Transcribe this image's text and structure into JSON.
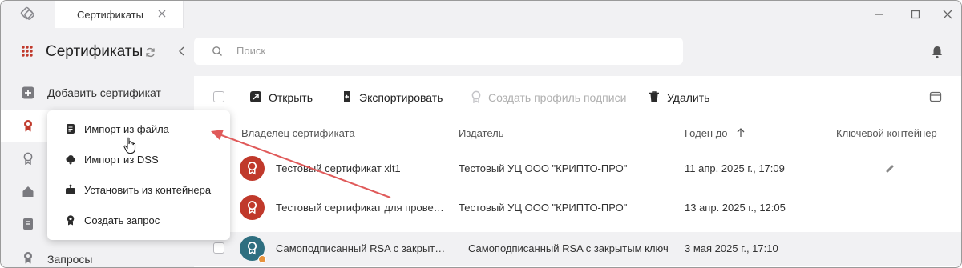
{
  "window": {
    "tab_title": "Сертификаты"
  },
  "sidebar": {
    "title": "Сертификаты",
    "add_label": "Добавить сертификат",
    "requests_label": "Запросы"
  },
  "search": {
    "placeholder": "Поиск"
  },
  "toolbar": {
    "open_label": "Открыть",
    "export_label": "Экспортировать",
    "create_profile_label": "Создать профиль подписи",
    "delete_label": "Удалить"
  },
  "table": {
    "headers": {
      "owner": "Владелец сертификата",
      "issuer": "Издатель",
      "valid_until": "Годен до",
      "key_container": "Ключевой контейнер"
    },
    "rows": [
      {
        "owner": "Тестовый сертификат xlt1",
        "issuer": "Тестовый УЦ ООО \"КРИПТО-ПРО\"",
        "valid_until": "11 апр. 2025 г., 17:09",
        "avatar_color": "#c0392b"
      },
      {
        "owner": "Тестовый сертификат для прове…",
        "issuer": "Тестовый УЦ ООО \"КРИПТО-ПРО\"",
        "valid_until": "13 апр. 2025 г., 12:05",
        "avatar_color": "#c0392b"
      },
      {
        "owner": "Самоподписанный RSA с закрыт…",
        "issuer": "Самоподписанный RSA с закрытым ключ…",
        "valid_until": "3 мая 2025 г., 17:10",
        "avatar_color": "#2f6f80"
      }
    ]
  },
  "add_menu": {
    "items": [
      {
        "label": "Импорт из файла",
        "icon": "file-icon"
      },
      {
        "label": "Импорт из DSS",
        "icon": "cloud-icon"
      },
      {
        "label": "Установить из контейнера",
        "icon": "container-icon"
      },
      {
        "label": "Создать запрос",
        "icon": "request-icon"
      }
    ]
  },
  "colors": {
    "accent_red": "#c0392b",
    "annotation_arrow": "#e05a5a",
    "sidebar_bg": "#f1f1f3"
  }
}
